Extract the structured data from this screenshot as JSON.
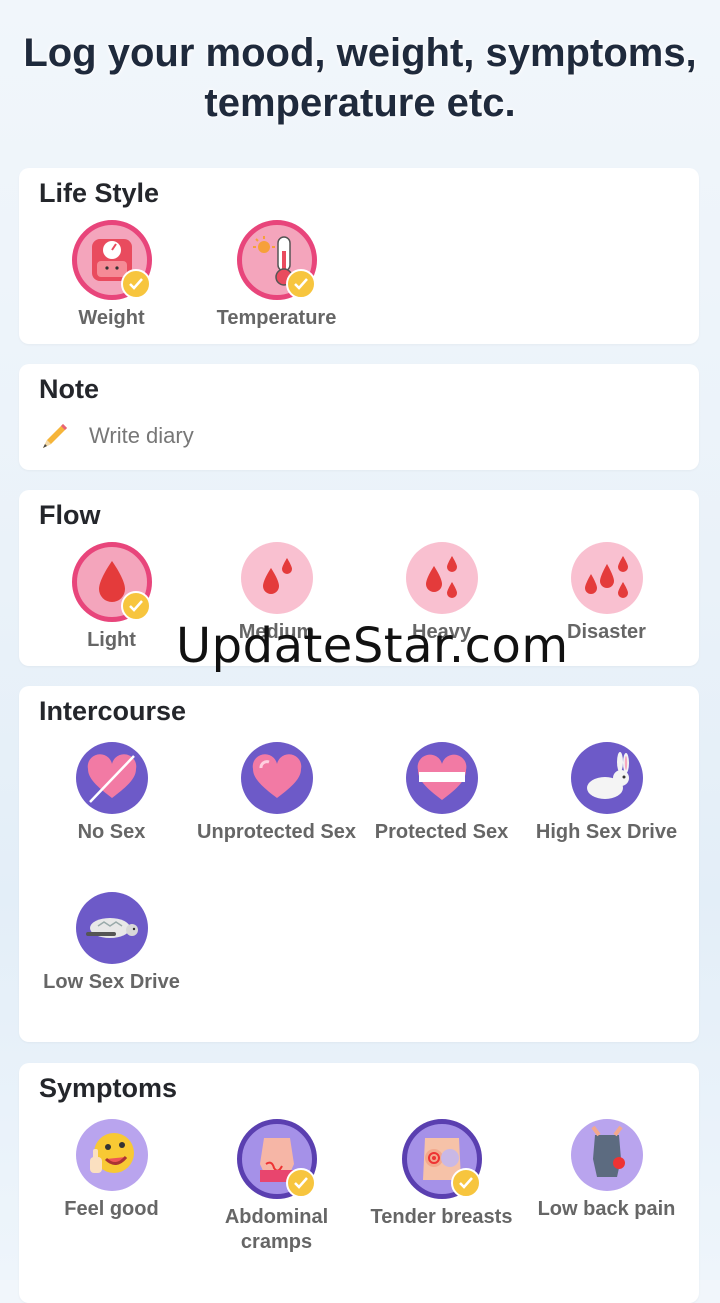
{
  "header": {
    "title_line1": "Log your mood, weight, symptoms,",
    "title_line2": "temperature etc."
  },
  "lifestyle": {
    "title": "Life Style",
    "items": [
      {
        "label": "Weight",
        "icon": "scale-icon",
        "checked": true
      },
      {
        "label": "Temperature",
        "icon": "thermometer-icon",
        "checked": true
      }
    ]
  },
  "note": {
    "title": "Note",
    "placeholder": "Write diary",
    "icon": "pencil-icon"
  },
  "flow": {
    "title": "Flow",
    "items": [
      {
        "label": "Light",
        "checked": true
      },
      {
        "label": "Medium"
      },
      {
        "label": "Heavy"
      },
      {
        "label": "Disaster"
      }
    ]
  },
  "intercourse": {
    "title": "Intercourse",
    "items": [
      {
        "label": "No Sex",
        "icon": "crossed-heart-icon"
      },
      {
        "label": "Unprotected Sex",
        "icon": "heart-icon"
      },
      {
        "label": "Protected Sex",
        "icon": "wrapped-heart-icon"
      },
      {
        "label": "High Sex Drive",
        "icon": "rabbit-icon"
      },
      {
        "label": "Low Sex Drive",
        "icon": "turtle-icon"
      }
    ]
  },
  "symptoms": {
    "title": "Symptoms",
    "items": [
      {
        "label": "Feel good",
        "icon": "thumbs-up-emoji-icon"
      },
      {
        "label": "Abdominal cramps",
        "icon": "abdomen-icon",
        "checked": true
      },
      {
        "label": "Tender breasts",
        "icon": "breast-icon",
        "checked": true
      },
      {
        "label": "Low back pain",
        "icon": "back-pain-icon"
      }
    ]
  },
  "watermark": "UpdateStar.com"
}
